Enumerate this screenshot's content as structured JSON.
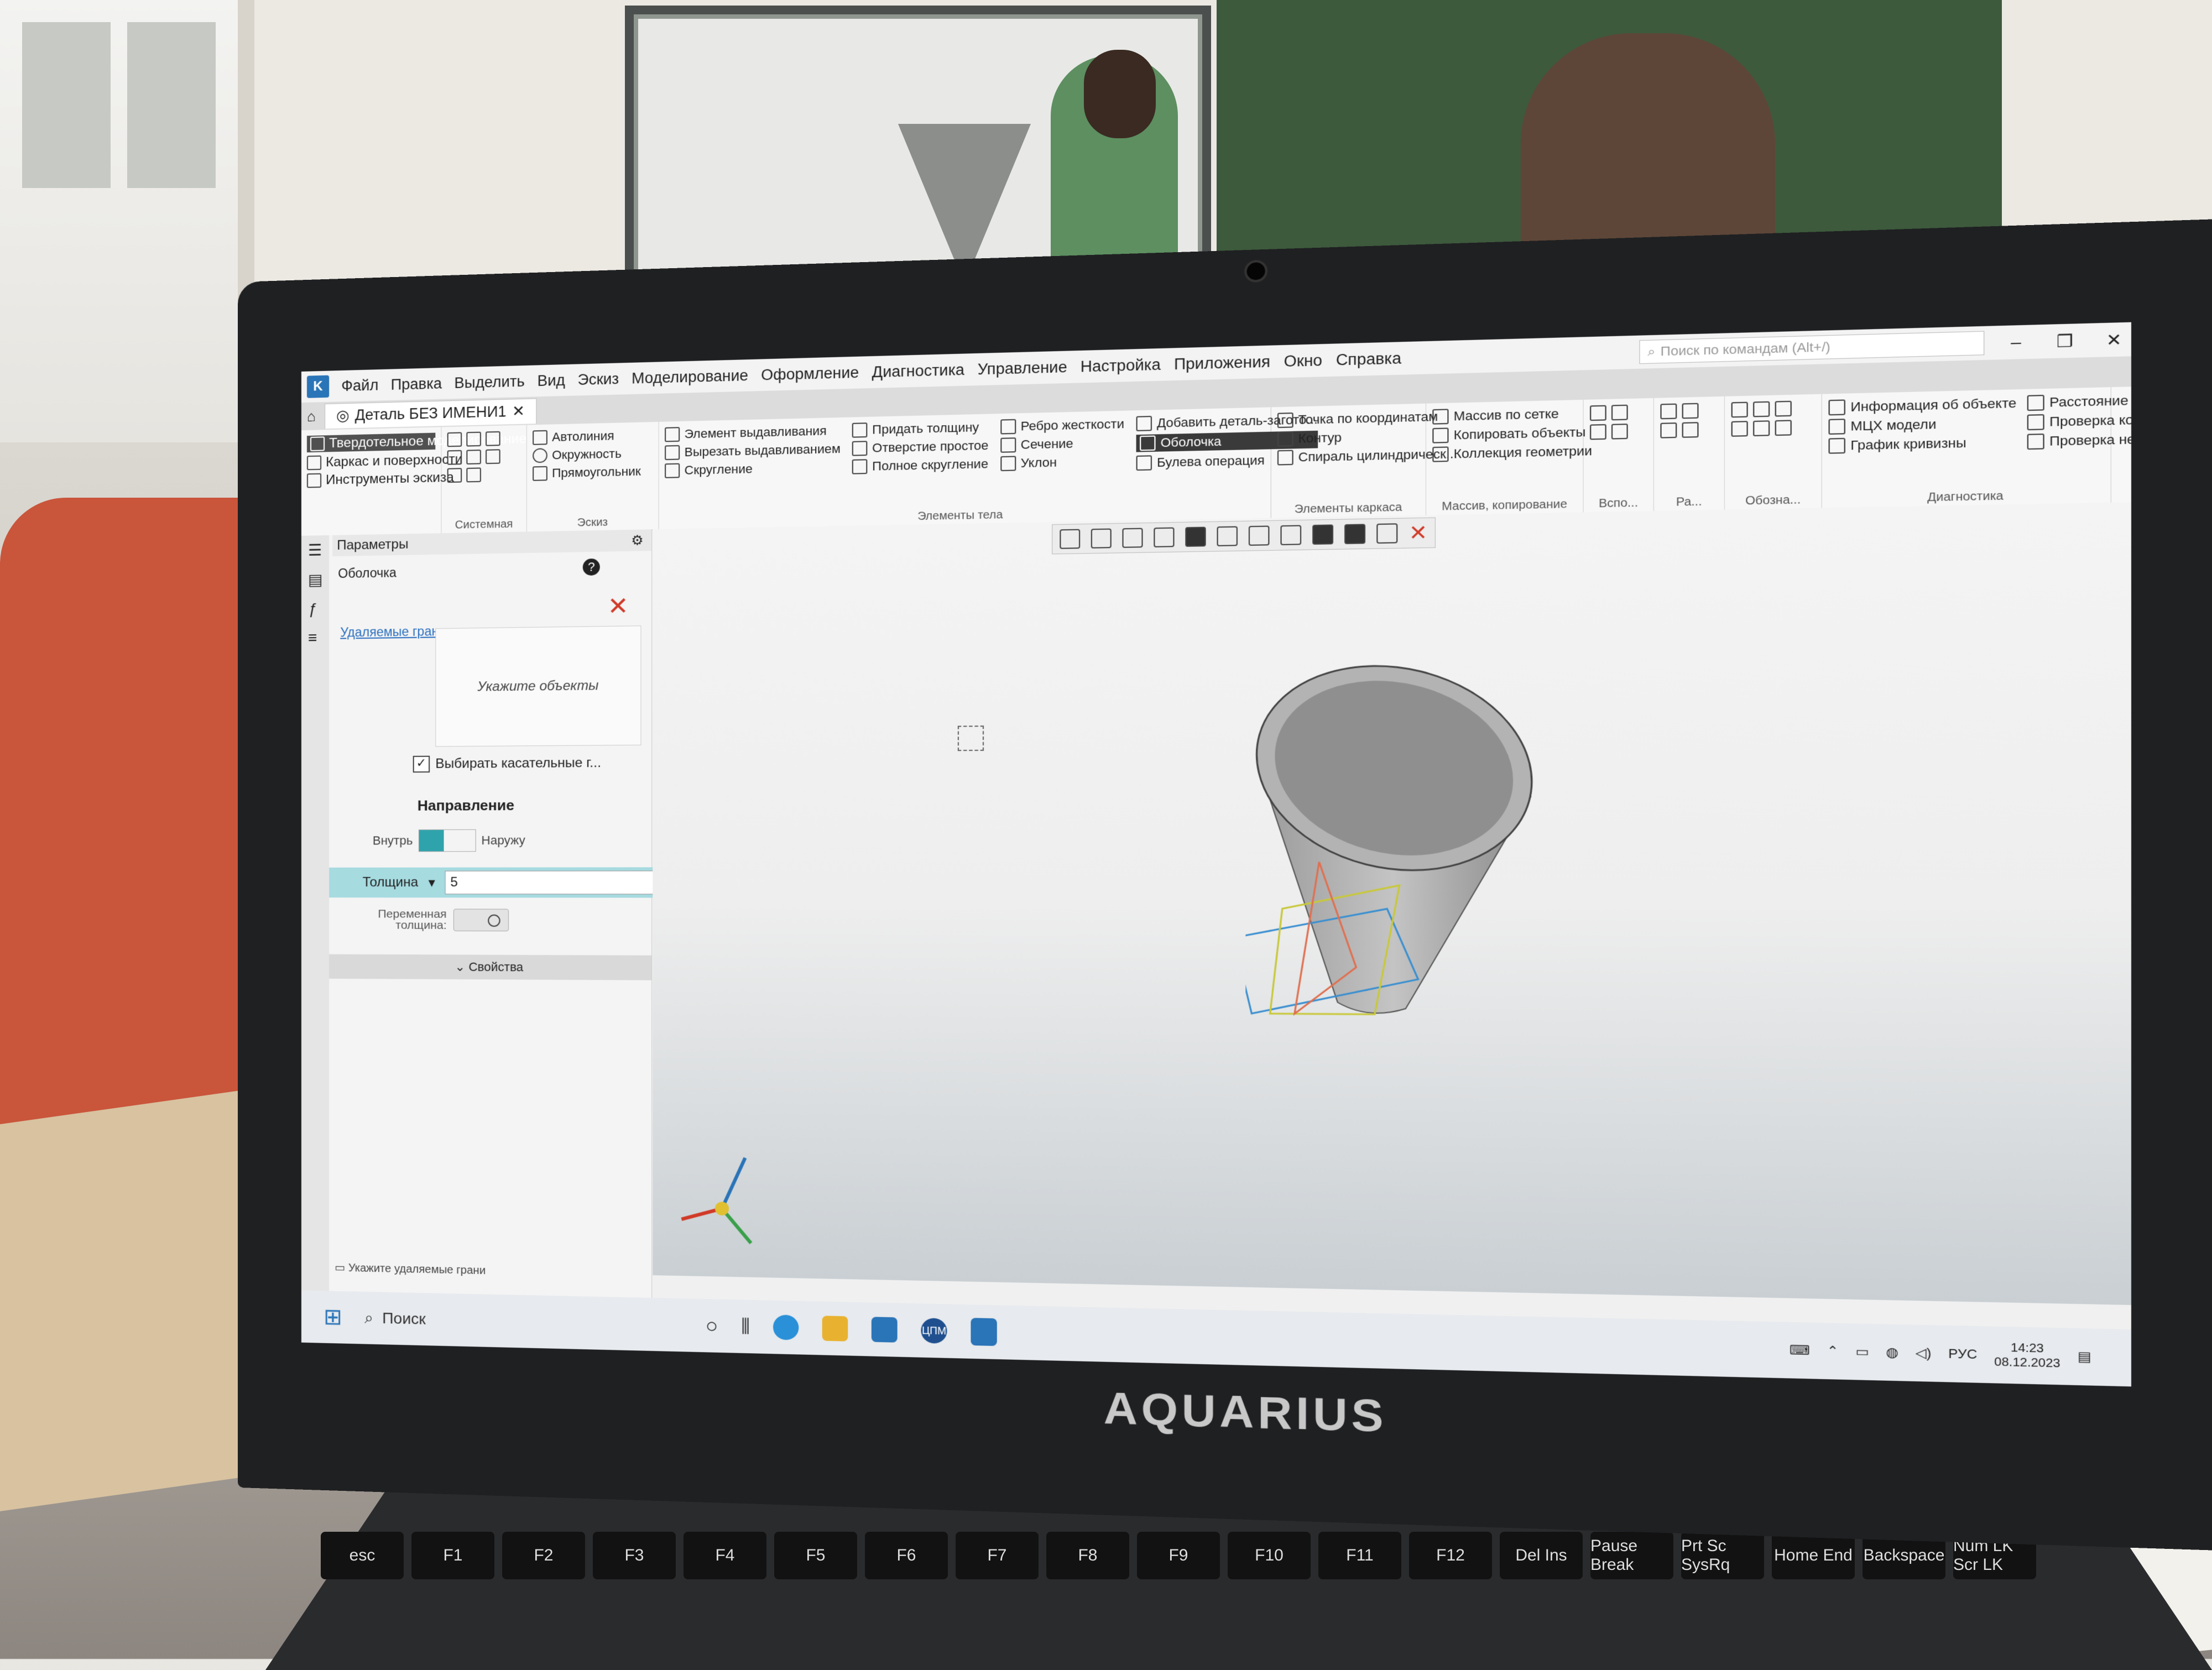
{
  "app": {
    "icon_letter": "K",
    "menu": [
      "Файл",
      "Правка",
      "Выделить",
      "Вид",
      "Эскиз",
      "Моделирование",
      "Оформление",
      "Диагностика",
      "Управление",
      "Настройка",
      "Приложения",
      "Окно",
      "Справка"
    ],
    "search_placeholder": "Поиск по командам (Alt+/)",
    "document_tab": "Деталь БЕЗ ИМЕНИ1"
  },
  "ribbon": {
    "categories": [
      "Твердотельное моделирование",
      "Каркас и поверхности",
      "Инструменты эскиза"
    ],
    "system_caption": "Системная",
    "sketch": {
      "items": [
        "Автолиния",
        "Окружность",
        "Прямоугольник"
      ],
      "caption": "Эскиз"
    },
    "body_col1": [
      "Элемент выдавливания",
      "Вырезать выдавливанием",
      "Скругление"
    ],
    "body_col2": [
      "Придать толщину",
      "Отверстие простое",
      "Полное скругление"
    ],
    "body_col3": [
      "Ребро жесткости",
      "Сечение",
      "Уклон"
    ],
    "body_col4": [
      "Добавить деталь-загото...",
      "Оболочка",
      "Булева операция"
    ],
    "body_caption": "Элементы тела",
    "frame": {
      "items": [
        "Точка по координатам",
        "Контур",
        "Спираль цилиндрическ..."
      ],
      "caption": "Элементы каркаса"
    },
    "array": {
      "items": [
        "Массив по сетке",
        "Копировать объекты",
        "Коллекция геометрии"
      ],
      "caption": "Массив, копирование"
    },
    "small_captions": [
      "Вспо...",
      "Ра...",
      "Обозна..."
    ],
    "diag": {
      "items": [
        "Информация об объекте",
        "МЦХ модели",
        "График кривизны",
        "Расстояние и угол",
        "Проверка коллизий",
        "Проверка непрерывности"
      ],
      "caption": "Диагностика"
    }
  },
  "params": {
    "header": "Параметры",
    "operation": "Оболочка",
    "faces_link": "Удаляемые грани",
    "faces_placeholder": "Укажите объекты",
    "tangent_checkbox": "Выбирать касательные г...",
    "direction_label": "Направление",
    "direction_in": "Внутрь",
    "direction_out": "Наружу",
    "thickness_label": "Толщина",
    "thickness_value": "5",
    "variable_thickness": "Переменная толщина:",
    "properties": "Свойства",
    "hint": "Укажите удаляемые грани"
  },
  "taskbar": {
    "search": "Поиск",
    "app_badge": "ЦПМ",
    "lang": "РУС",
    "time": "14:23",
    "date": "08.12.2023"
  },
  "laptop": {
    "brand": "AQUARIUS"
  },
  "keyboard": {
    "keys": [
      "esc",
      "F1",
      "F2",
      "F3",
      "F4",
      "F5",
      "F6",
      "F7",
      "F8",
      "F9",
      "F10",
      "F11",
      "F12",
      "Del Ins",
      "Pause Break",
      "Prt Sc SysRq",
      "Home End",
      "Backspace",
      "Num LK Scr LK"
    ]
  },
  "colors": {
    "accent_teal": "#2fa3ac",
    "close_red": "#d03a28",
    "kompas_blue": "#2a74b8"
  }
}
